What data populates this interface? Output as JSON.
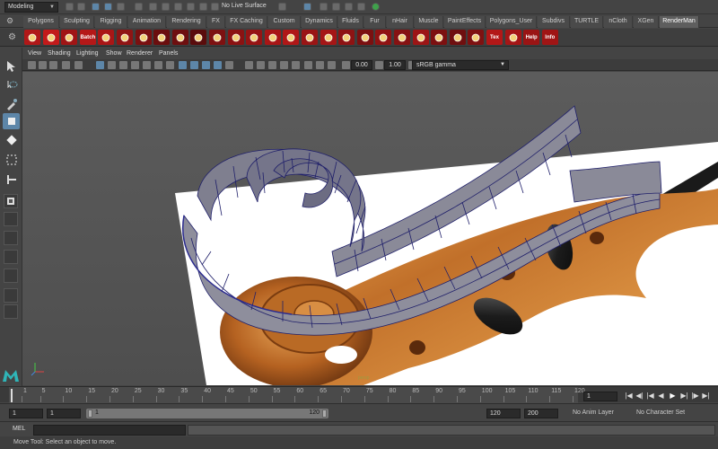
{
  "status_line": {
    "mode": "Modeling",
    "live_surface": "No Live Surface"
  },
  "shelf_tabs": [
    "Polygons",
    "Sculpting",
    "Rigging",
    "Animation",
    "Rendering",
    "FX",
    "FX Caching",
    "Custom",
    "Dynamics",
    "Fluids",
    "Fur",
    "nHair",
    "Muscle",
    "PaintEffects",
    "Polygons_User",
    "Subdivs",
    "TURTLE",
    "nCloth",
    "XGen",
    "RenderMan"
  ],
  "active_shelf_tab": "RenderMan",
  "shelf_buttons": [
    {
      "icon": "render-settings-icon",
      "label": "",
      "color": "#b01818"
    },
    {
      "icon": "render-icon",
      "label": "",
      "color": "#c21a1a"
    },
    {
      "icon": "ipr-icon",
      "label": "",
      "color": "#a01515"
    },
    {
      "icon": "batch-render-icon",
      "label": "Batch",
      "color": "#b51818"
    },
    {
      "icon": "renderman-eye-icon",
      "label": "",
      "color": "#aa1616"
    },
    {
      "icon": "eye-icon",
      "label": "",
      "color": "#901414"
    },
    {
      "icon": "light-icon",
      "label": "",
      "color": "#7a1010"
    },
    {
      "icon": "sphere-light-icon",
      "label": "",
      "color": "#6b0e0e"
    },
    {
      "icon": "env-light-icon",
      "label": "",
      "color": "#6e0f0f"
    },
    {
      "icon": "shader-icon",
      "label": "",
      "color": "#5a0c0c"
    },
    {
      "icon": "material-icon",
      "label": "",
      "color": "#7d1111"
    },
    {
      "icon": "bulb-icon",
      "label": "",
      "color": "#8b1212"
    },
    {
      "icon": "pattern-icon",
      "label": "",
      "color": "#961414"
    },
    {
      "icon": "daylight-icon",
      "label": "",
      "color": "#a81616"
    },
    {
      "icon": "area-light-icon",
      "label": "",
      "color": "#b01717"
    },
    {
      "icon": "lips-icon",
      "label": "",
      "color": "#9a1515"
    },
    {
      "icon": "cup-icon",
      "label": "",
      "color": "#a51616"
    },
    {
      "icon": "camera-icon",
      "label": "",
      "color": "#8e1313"
    },
    {
      "icon": "film-icon",
      "label": "",
      "color": "#7b1010"
    },
    {
      "icon": "shutter-icon",
      "label": "",
      "color": "#901313"
    },
    {
      "icon": "plant-icon",
      "label": "",
      "color": "#861212"
    },
    {
      "icon": "stars-icon",
      "label": "",
      "color": "#9c1515"
    },
    {
      "icon": "coin-icon",
      "label": "",
      "color": "#7c1010"
    },
    {
      "icon": "grid-icon",
      "label": "",
      "color": "#6f0f0f"
    },
    {
      "icon": "cube-icon",
      "label": "",
      "color": "#7e1111"
    },
    {
      "icon": "texture-icon",
      "label": "Tex",
      "color": "#b31717"
    },
    {
      "icon": "curve-icon",
      "label": "",
      "color": "#a41616"
    },
    {
      "icon": "help-icon",
      "label": "Help",
      "color": "#9a1414"
    },
    {
      "icon": "info-icon",
      "label": "Info",
      "color": "#a01515"
    }
  ],
  "panel_menu": [
    "View",
    "Shading",
    "Lighting",
    "Show",
    "Renderer",
    "Panels"
  ],
  "panel_toolbar": {
    "exposure": "0.00",
    "gamma_value": "1.00",
    "color_space": "sRGB gamma"
  },
  "viewport": {
    "camera_label": "persp"
  },
  "timeline": {
    "ticks": [
      "1",
      "5",
      "10",
      "15",
      "20",
      "25",
      "30",
      "35",
      "40",
      "45",
      "50",
      "55",
      "60",
      "65",
      "70",
      "75",
      "80",
      "85",
      "90",
      "95",
      "100",
      "105",
      "110",
      "115",
      "120"
    ],
    "current_frame": "1"
  },
  "range_slider": {
    "start": "1",
    "playback_start": "1",
    "range_left": "1",
    "range_right": "120",
    "playback_end": "120",
    "end": "200",
    "anim_layer": "No Anim Layer",
    "character_set": "No Character Set"
  },
  "command_line": {
    "language": "MEL"
  },
  "help_line": "Move Tool: Select an object to move."
}
